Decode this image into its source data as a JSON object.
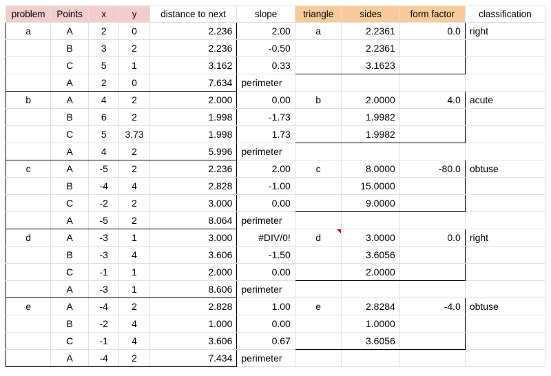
{
  "headers": {
    "problem": "problem",
    "points": "Points",
    "x": "x",
    "y": "y",
    "dist": "distance to next",
    "slope": "slope",
    "triangle": "triangle",
    "sides": "sides",
    "formfactor": "form factor",
    "classification": "classification"
  },
  "perim_label": "perimeter",
  "problems": [
    {
      "id": "a",
      "triangle": "a",
      "form_factor": "0.0",
      "classification": "right",
      "sides": [
        "2.2361",
        "2.2361",
        "3.1623"
      ],
      "rows": [
        {
          "pt": "A",
          "x": "2",
          "y": "0",
          "dist": "2.236",
          "slope": "2.00"
        },
        {
          "pt": "B",
          "x": "3",
          "y": "2",
          "dist": "2.236",
          "slope": "-0.50"
        },
        {
          "pt": "C",
          "x": "5",
          "y": "1",
          "dist": "3.162",
          "slope": "0.33"
        },
        {
          "pt": "A",
          "x": "2",
          "y": "0",
          "dist": "7.634",
          "slope": ""
        }
      ]
    },
    {
      "id": "b",
      "triangle": "b",
      "form_factor": "4.0",
      "classification": "acute",
      "sides": [
        "2.0000",
        "1.9982",
        "1.9982"
      ],
      "rows": [
        {
          "pt": "A",
          "x": "4",
          "y": "2",
          "dist": "2.000",
          "slope": "0.00"
        },
        {
          "pt": "B",
          "x": "6",
          "y": "2",
          "dist": "1.998",
          "slope": "-1.73"
        },
        {
          "pt": "C",
          "x": "5",
          "y": "3.73",
          "dist": "1.998",
          "slope": "1.73"
        },
        {
          "pt": "A",
          "x": "4",
          "y": "2",
          "dist": "5.996",
          "slope": ""
        }
      ]
    },
    {
      "id": "c",
      "triangle": "c",
      "form_factor": "-80.0",
      "classification": "obtuse",
      "sides": [
        "8.0000",
        "15.0000",
        "9.0000"
      ],
      "rows": [
        {
          "pt": "A",
          "x": "-5",
          "y": "2",
          "dist": "2.236",
          "slope": "2.00"
        },
        {
          "pt": "B",
          "x": "-4",
          "y": "4",
          "dist": "2.828",
          "slope": "-1.00"
        },
        {
          "pt": "C",
          "x": "-2",
          "y": "2",
          "dist": "3.000",
          "slope": "0.00"
        },
        {
          "pt": "A",
          "x": "-5",
          "y": "2",
          "dist": "8.064",
          "slope": ""
        }
      ]
    },
    {
      "id": "d",
      "triangle": "d",
      "form_factor": "0.0",
      "classification": "right",
      "sides": [
        "3.0000",
        "3.6056",
        "2.0000"
      ],
      "rows": [
        {
          "pt": "A",
          "x": "-3",
          "y": "1",
          "dist": "3.000",
          "slope": "#DIV/0!"
        },
        {
          "pt": "B",
          "x": "-3",
          "y": "4",
          "dist": "3.606",
          "slope": "-1.50"
        },
        {
          "pt": "C",
          "x": "-1",
          "y": "1",
          "dist": "2.000",
          "slope": "0.00"
        },
        {
          "pt": "A",
          "x": "-3",
          "y": "1",
          "dist": "8.606",
          "slope": ""
        }
      ]
    },
    {
      "id": "e",
      "triangle": "e",
      "form_factor": "-4.0",
      "classification": "obtuse",
      "sides": [
        "2.8284",
        "1.0000",
        "3.6056"
      ],
      "rows": [
        {
          "pt": "A",
          "x": "-4",
          "y": "2",
          "dist": "2.828",
          "slope": "1.00"
        },
        {
          "pt": "B",
          "x": "-2",
          "y": "4",
          "dist": "1.000",
          "slope": "0.00"
        },
        {
          "pt": "C",
          "x": "-1",
          "y": "4",
          "dist": "3.606",
          "slope": "0.67"
        },
        {
          "pt": "A",
          "x": "-4",
          "y": "2",
          "dist": "7.434",
          "slope": ""
        }
      ]
    }
  ]
}
